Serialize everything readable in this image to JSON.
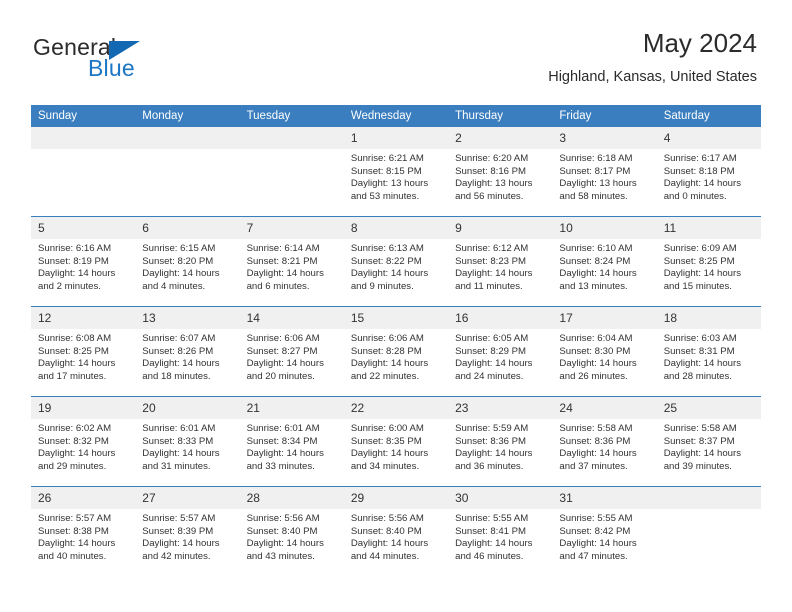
{
  "logo": {
    "word_one": "General",
    "word_two": "Blue",
    "triangle_icon": "triangle-icon"
  },
  "header": {
    "title": "May 2024",
    "location": "Highland, Kansas, United States"
  },
  "colors": {
    "header_blue": "#3a7ebf",
    "logo_blue": "#1c76c4",
    "daynum_bg": "#f0f0f0",
    "text": "#333333"
  },
  "weekday_headers": [
    "Sunday",
    "Monday",
    "Tuesday",
    "Wednesday",
    "Thursday",
    "Friday",
    "Saturday"
  ],
  "weeks": [
    [
      {
        "day": "",
        "sunrise": "",
        "sunset": "",
        "daylight_line1": "",
        "daylight_line2": ""
      },
      {
        "day": "",
        "sunrise": "",
        "sunset": "",
        "daylight_line1": "",
        "daylight_line2": ""
      },
      {
        "day": "",
        "sunrise": "",
        "sunset": "",
        "daylight_line1": "",
        "daylight_line2": ""
      },
      {
        "day": "1",
        "sunrise": "Sunrise: 6:21 AM",
        "sunset": "Sunset: 8:15 PM",
        "daylight_line1": "Daylight: 13 hours",
        "daylight_line2": "and 53 minutes."
      },
      {
        "day": "2",
        "sunrise": "Sunrise: 6:20 AM",
        "sunset": "Sunset: 8:16 PM",
        "daylight_line1": "Daylight: 13 hours",
        "daylight_line2": "and 56 minutes."
      },
      {
        "day": "3",
        "sunrise": "Sunrise: 6:18 AM",
        "sunset": "Sunset: 8:17 PM",
        "daylight_line1": "Daylight: 13 hours",
        "daylight_line2": "and 58 minutes."
      },
      {
        "day": "4",
        "sunrise": "Sunrise: 6:17 AM",
        "sunset": "Sunset: 8:18 PM",
        "daylight_line1": "Daylight: 14 hours",
        "daylight_line2": "and 0 minutes."
      }
    ],
    [
      {
        "day": "5",
        "sunrise": "Sunrise: 6:16 AM",
        "sunset": "Sunset: 8:19 PM",
        "daylight_line1": "Daylight: 14 hours",
        "daylight_line2": "and 2 minutes."
      },
      {
        "day": "6",
        "sunrise": "Sunrise: 6:15 AM",
        "sunset": "Sunset: 8:20 PM",
        "daylight_line1": "Daylight: 14 hours",
        "daylight_line2": "and 4 minutes."
      },
      {
        "day": "7",
        "sunrise": "Sunrise: 6:14 AM",
        "sunset": "Sunset: 8:21 PM",
        "daylight_line1": "Daylight: 14 hours",
        "daylight_line2": "and 6 minutes."
      },
      {
        "day": "8",
        "sunrise": "Sunrise: 6:13 AM",
        "sunset": "Sunset: 8:22 PM",
        "daylight_line1": "Daylight: 14 hours",
        "daylight_line2": "and 9 minutes."
      },
      {
        "day": "9",
        "sunrise": "Sunrise: 6:12 AM",
        "sunset": "Sunset: 8:23 PM",
        "daylight_line1": "Daylight: 14 hours",
        "daylight_line2": "and 11 minutes."
      },
      {
        "day": "10",
        "sunrise": "Sunrise: 6:10 AM",
        "sunset": "Sunset: 8:24 PM",
        "daylight_line1": "Daylight: 14 hours",
        "daylight_line2": "and 13 minutes."
      },
      {
        "day": "11",
        "sunrise": "Sunrise: 6:09 AM",
        "sunset": "Sunset: 8:25 PM",
        "daylight_line1": "Daylight: 14 hours",
        "daylight_line2": "and 15 minutes."
      }
    ],
    [
      {
        "day": "12",
        "sunrise": "Sunrise: 6:08 AM",
        "sunset": "Sunset: 8:25 PM",
        "daylight_line1": "Daylight: 14 hours",
        "daylight_line2": "and 17 minutes."
      },
      {
        "day": "13",
        "sunrise": "Sunrise: 6:07 AM",
        "sunset": "Sunset: 8:26 PM",
        "daylight_line1": "Daylight: 14 hours",
        "daylight_line2": "and 18 minutes."
      },
      {
        "day": "14",
        "sunrise": "Sunrise: 6:06 AM",
        "sunset": "Sunset: 8:27 PM",
        "daylight_line1": "Daylight: 14 hours",
        "daylight_line2": "and 20 minutes."
      },
      {
        "day": "15",
        "sunrise": "Sunrise: 6:06 AM",
        "sunset": "Sunset: 8:28 PM",
        "daylight_line1": "Daylight: 14 hours",
        "daylight_line2": "and 22 minutes."
      },
      {
        "day": "16",
        "sunrise": "Sunrise: 6:05 AM",
        "sunset": "Sunset: 8:29 PM",
        "daylight_line1": "Daylight: 14 hours",
        "daylight_line2": "and 24 minutes."
      },
      {
        "day": "17",
        "sunrise": "Sunrise: 6:04 AM",
        "sunset": "Sunset: 8:30 PM",
        "daylight_line1": "Daylight: 14 hours",
        "daylight_line2": "and 26 minutes."
      },
      {
        "day": "18",
        "sunrise": "Sunrise: 6:03 AM",
        "sunset": "Sunset: 8:31 PM",
        "daylight_line1": "Daylight: 14 hours",
        "daylight_line2": "and 28 minutes."
      }
    ],
    [
      {
        "day": "19",
        "sunrise": "Sunrise: 6:02 AM",
        "sunset": "Sunset: 8:32 PM",
        "daylight_line1": "Daylight: 14 hours",
        "daylight_line2": "and 29 minutes."
      },
      {
        "day": "20",
        "sunrise": "Sunrise: 6:01 AM",
        "sunset": "Sunset: 8:33 PM",
        "daylight_line1": "Daylight: 14 hours",
        "daylight_line2": "and 31 minutes."
      },
      {
        "day": "21",
        "sunrise": "Sunrise: 6:01 AM",
        "sunset": "Sunset: 8:34 PM",
        "daylight_line1": "Daylight: 14 hours",
        "daylight_line2": "and 33 minutes."
      },
      {
        "day": "22",
        "sunrise": "Sunrise: 6:00 AM",
        "sunset": "Sunset: 8:35 PM",
        "daylight_line1": "Daylight: 14 hours",
        "daylight_line2": "and 34 minutes."
      },
      {
        "day": "23",
        "sunrise": "Sunrise: 5:59 AM",
        "sunset": "Sunset: 8:36 PM",
        "daylight_line1": "Daylight: 14 hours",
        "daylight_line2": "and 36 minutes."
      },
      {
        "day": "24",
        "sunrise": "Sunrise: 5:58 AM",
        "sunset": "Sunset: 8:36 PM",
        "daylight_line1": "Daylight: 14 hours",
        "daylight_line2": "and 37 minutes."
      },
      {
        "day": "25",
        "sunrise": "Sunrise: 5:58 AM",
        "sunset": "Sunset: 8:37 PM",
        "daylight_line1": "Daylight: 14 hours",
        "daylight_line2": "and 39 minutes."
      }
    ],
    [
      {
        "day": "26",
        "sunrise": "Sunrise: 5:57 AM",
        "sunset": "Sunset: 8:38 PM",
        "daylight_line1": "Daylight: 14 hours",
        "daylight_line2": "and 40 minutes."
      },
      {
        "day": "27",
        "sunrise": "Sunrise: 5:57 AM",
        "sunset": "Sunset: 8:39 PM",
        "daylight_line1": "Daylight: 14 hours",
        "daylight_line2": "and 42 minutes."
      },
      {
        "day": "28",
        "sunrise": "Sunrise: 5:56 AM",
        "sunset": "Sunset: 8:40 PM",
        "daylight_line1": "Daylight: 14 hours",
        "daylight_line2": "and 43 minutes."
      },
      {
        "day": "29",
        "sunrise": "Sunrise: 5:56 AM",
        "sunset": "Sunset: 8:40 PM",
        "daylight_line1": "Daylight: 14 hours",
        "daylight_line2": "and 44 minutes."
      },
      {
        "day": "30",
        "sunrise": "Sunrise: 5:55 AM",
        "sunset": "Sunset: 8:41 PM",
        "daylight_line1": "Daylight: 14 hours",
        "daylight_line2": "and 46 minutes."
      },
      {
        "day": "31",
        "sunrise": "Sunrise: 5:55 AM",
        "sunset": "Sunset: 8:42 PM",
        "daylight_line1": "Daylight: 14 hours",
        "daylight_line2": "and 47 minutes."
      },
      {
        "day": "",
        "sunrise": "",
        "sunset": "",
        "daylight_line1": "",
        "daylight_line2": ""
      }
    ]
  ]
}
